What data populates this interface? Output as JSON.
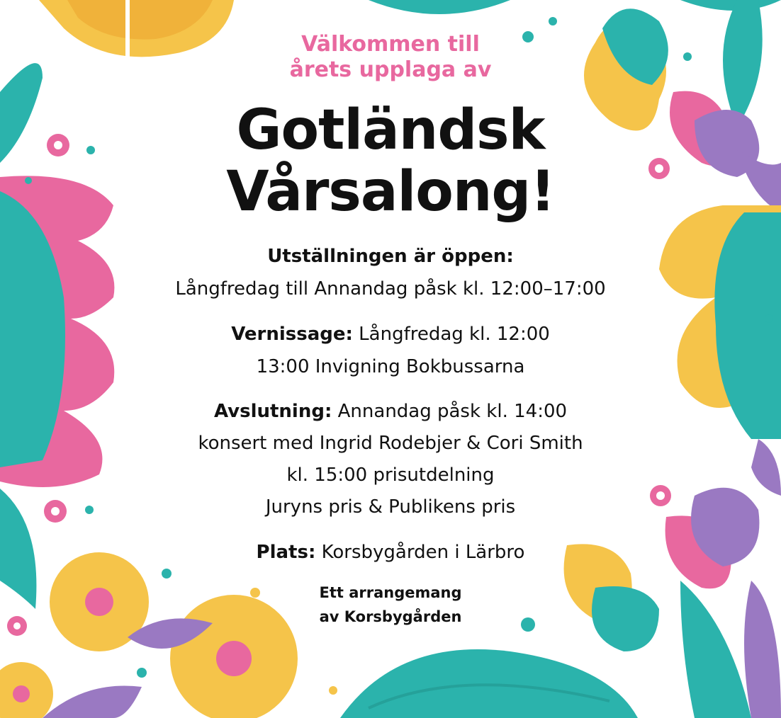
{
  "intro": {
    "line1": "Välkommen till",
    "line2": "årets upplaga av"
  },
  "title": {
    "line1": "Gotländsk",
    "line2": "Vårsalong!"
  },
  "open": {
    "heading": "Utställningen är öppen:",
    "hours": "Långfredag till Annandag påsk kl. 12:00–17:00"
  },
  "vernissage": {
    "label": "Vernissage:",
    "time": "Långfredag kl. 12:00",
    "line2": "13:00 Invigning Bokbussarna"
  },
  "closing": {
    "label": "Avslutning:",
    "time": "Annandag påsk kl. 14:00",
    "line2": "konsert med Ingrid Rodebjer & Cori Smith",
    "line3": "kl. 15:00 prisutdelning",
    "line4": "Juryns pris & Publikens pris"
  },
  "place": {
    "label": "Plats:",
    "value": "Korsbygården i Lärbro"
  },
  "organizer": {
    "line1": "Ett arrangemang",
    "line2": "av Korsbygården"
  },
  "colors": {
    "pink": "#e8689f",
    "teal": "#2bb3ac",
    "yellow": "#f5c44a",
    "purple": "#9a79c2",
    "text": "#111111"
  },
  "decor_icons": [
    "waffle-icon",
    "flower-icon",
    "leaf-icon",
    "tulip-icon",
    "daisy-icon"
  ]
}
